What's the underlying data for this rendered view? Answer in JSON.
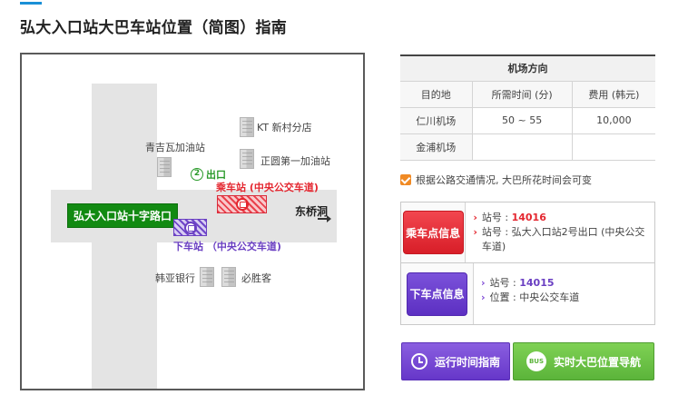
{
  "page": {
    "title": "弘大入口站大巴车站位置（简图）指南"
  },
  "map": {
    "labels": {
      "kt_branch": "KT 新村分店",
      "gas_station_1": "青吉瓦加油站",
      "gas_station_2": "正圆第一加油站",
      "exit": "出口",
      "exit_number": "2",
      "intersection": "弘大入口站十字路口",
      "boarding_stop": "乘车站 (中央公交车道)",
      "alighting_stop": "下车站 （中央公交车道)",
      "east": "东桥洞",
      "bank": "韩亚银行",
      "church": "必胜客"
    }
  },
  "airport_table": {
    "caption": "机场方向",
    "headers": [
      "目的地",
      "所需时间 (分)",
      "费用 (韩元)"
    ],
    "rows": [
      [
        "仁川机场",
        "50 ~ 55",
        "10,000"
      ],
      [
        "金浦机场",
        "",
        ""
      ]
    ]
  },
  "notice": "根据公路交通情况, 大巴所花时间会可变",
  "boarding": {
    "button": "乘车点信息",
    "stop_label": "站号 : ",
    "stop_number": "14016",
    "location": "站号 : 弘大入口站2号出口 (中央公交车道)"
  },
  "alighting": {
    "button": "下车点信息",
    "stop_label": "站号 : ",
    "stop_number": "14015",
    "location": "位置 : 中央公交车道"
  },
  "buttons": {
    "schedule": "运行时间指南",
    "realtime": "实时大巴位置导航",
    "bus_badge": "BUS"
  },
  "colors": {
    "accent": "#1a8fd6",
    "boarding_red": "#e4262f",
    "alighting_purple": "#6a3fc2",
    "realtime_green": "#5bb43a",
    "intersection_green": "#128a12"
  }
}
